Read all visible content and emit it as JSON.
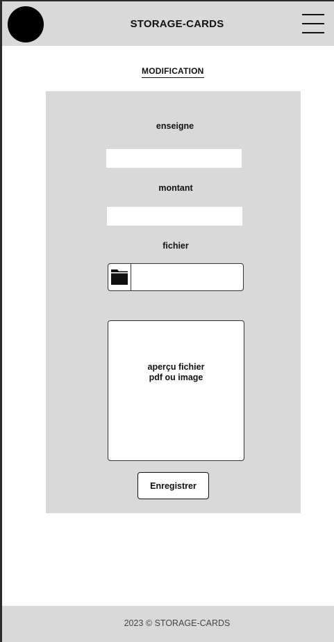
{
  "header": {
    "title": "STORAGE-CARDS",
    "logo_icon": "logo-circle",
    "menu_icon": "hamburger-menu-icon"
  },
  "page": {
    "heading": "MODIFICATION"
  },
  "form": {
    "enseigne": {
      "label": "enseigne",
      "value": "",
      "placeholder": ""
    },
    "montant": {
      "label": "montant",
      "value": "",
      "placeholder": ""
    },
    "fichier": {
      "label": "fichier",
      "icon": "folder-icon",
      "filename": ""
    },
    "preview": {
      "line1": "aperçu fichier",
      "line2": "pdf ou image"
    },
    "submit_label": "Enregistrer"
  },
  "footer": {
    "text": "2023 © STORAGE-CARDS"
  },
  "colors": {
    "panel_bg": "#d9d9d9",
    "text": "#111111",
    "logo": "#000000"
  }
}
